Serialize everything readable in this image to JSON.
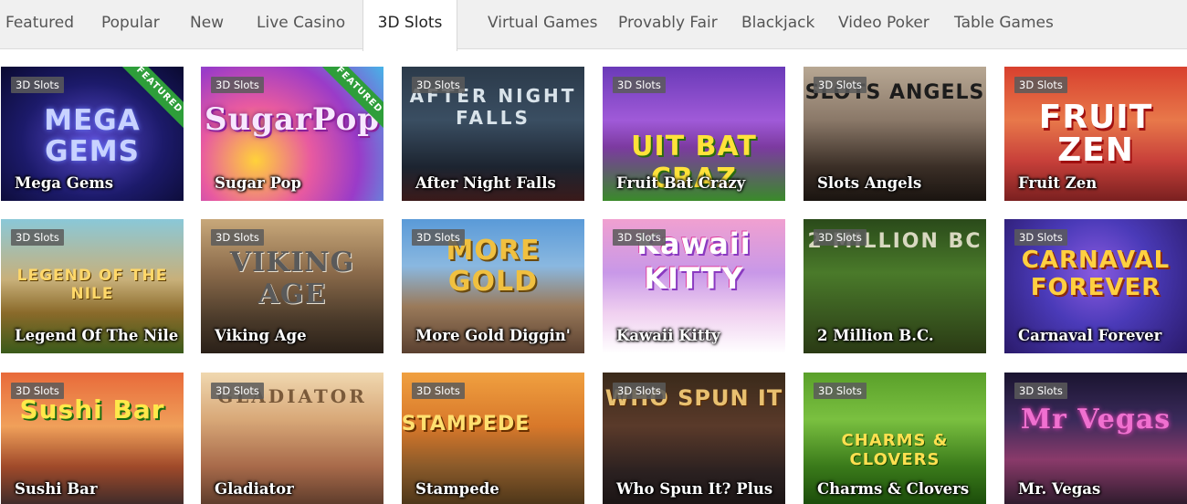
{
  "tabs": [
    {
      "label": "Featured"
    },
    {
      "label": "Popular"
    },
    {
      "label": "New"
    },
    {
      "label": "Live Casino"
    },
    {
      "label": "3D Slots"
    },
    {
      "label": "Virtual Games"
    },
    {
      "label": "Provably Fair"
    },
    {
      "label": "Blackjack"
    },
    {
      "label": "Video Poker"
    },
    {
      "label": "Table Games"
    }
  ],
  "active_tab": "3D Slots",
  "games": [
    {
      "name": "Mega Gems",
      "badge": "3D Slots",
      "featured": "FEATURED",
      "logo": "MEGA GEMS"
    },
    {
      "name": "Sugar Pop",
      "badge": "3D Slots",
      "featured": "FEATURED",
      "logo": "SugarPop"
    },
    {
      "name": "After Night Falls",
      "badge": "3D Slots",
      "logo": "AFTER NIGHT FALLS"
    },
    {
      "name": "Fruit Bat Crazy",
      "badge": "3D Slots",
      "logo": "UIT BAT CRAZ"
    },
    {
      "name": "Slots Angels",
      "badge": "3D Slots",
      "logo": "SLOTS ANGELS"
    },
    {
      "name": "Fruit Zen",
      "badge": "3D Slots",
      "logo": "FRUIT ZEN"
    },
    {
      "name": "Legend Of The Nile",
      "badge": "3D Slots",
      "logo": "LEGEND OF THE NILE"
    },
    {
      "name": "Viking Age",
      "badge": "3D Slots",
      "logo": "VIKING AGE"
    },
    {
      "name": "More Gold Diggin'",
      "badge": "3D Slots",
      "logo": "MORE GOLD DIGGIN'"
    },
    {
      "name": "Kawaii Kitty",
      "badge": "3D Slots",
      "logo": "Kawaii KITTY"
    },
    {
      "name": "2 Million B.C.",
      "badge": "3D Slots",
      "logo": "2 MILLION BC"
    },
    {
      "name": "Carnaval Forever",
      "badge": "3D Slots",
      "logo": "CARNAVAL FOREVER"
    },
    {
      "name": "Sushi Bar",
      "badge": "3D Slots",
      "logo": "Sushi Bar"
    },
    {
      "name": "Gladiator",
      "badge": "3D Slots",
      "logo": "GLADIATOR"
    },
    {
      "name": "Stampede",
      "badge": "3D Slots",
      "logo": "STAMPEDE"
    },
    {
      "name": "Who Spun It? Plus",
      "badge": "3D Slots",
      "logo": "WHO SPUN IT"
    },
    {
      "name": "Charms & Clovers",
      "badge": "3D Slots",
      "logo": "CHARMS & CLOVERS"
    },
    {
      "name": "Mr. Vegas",
      "badge": "3D Slots",
      "logo": "Mr Vegas"
    }
  ],
  "colors": {
    "tabbar_bg": "#f0f0f0",
    "featured_ribbon": "#2e9e3a",
    "badge_bg": "#5a5a5a"
  }
}
